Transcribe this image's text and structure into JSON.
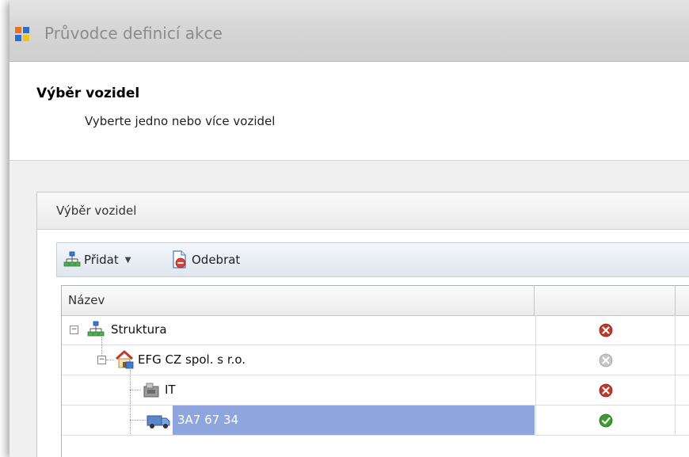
{
  "window": {
    "title": "Průvodce definicí akce"
  },
  "header": {
    "title": "Výběr vozidel",
    "subtitle": "Vyberte jedno nebo více vozidel"
  },
  "group": {
    "title": "Výběr vozidel"
  },
  "toolbar": {
    "add_label": "Přidat",
    "remove_label": "Odebrat"
  },
  "grid": {
    "columns": [
      "Název",
      ""
    ],
    "rows": [
      {
        "label": "Struktura",
        "status": "remove"
      },
      {
        "label": "EFG CZ spol. s r.o.",
        "status": "remove-disabled"
      },
      {
        "label": "IT",
        "status": "remove"
      },
      {
        "label": "3A7 67 34",
        "status": "ok",
        "selected": true
      }
    ]
  },
  "colors": {
    "selection": "#8fa5dd",
    "status_remove": "#c0392b",
    "status_ok": "#3c9a2e",
    "status_disabled": "#b8b8b8"
  }
}
